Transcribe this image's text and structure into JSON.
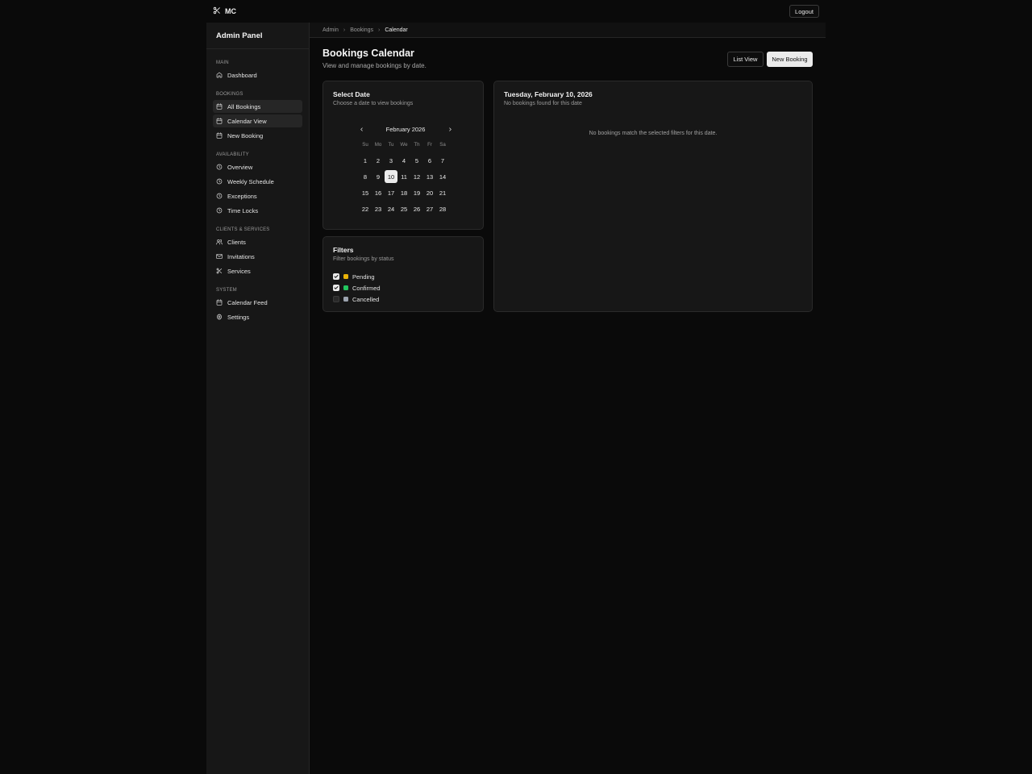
{
  "brand": {
    "name": "MC"
  },
  "topbar": {
    "logout_label": "Logout"
  },
  "sidebar": {
    "title": "Admin Panel",
    "sections": [
      {
        "label": "MAIN",
        "items": [
          {
            "label": "Dashboard",
            "icon": "home-icon",
            "active": false
          }
        ]
      },
      {
        "label": "BOOKINGS",
        "items": [
          {
            "label": "All Bookings",
            "icon": "calendar-icon",
            "active": true
          },
          {
            "label": "Calendar View",
            "icon": "calendar-icon",
            "active": true
          },
          {
            "label": "New Booking",
            "icon": "calendar-icon",
            "active": false
          }
        ]
      },
      {
        "label": "AVAILABILITY",
        "items": [
          {
            "label": "Overview",
            "icon": "clock-icon",
            "active": false
          },
          {
            "label": "Weekly Schedule",
            "icon": "clock-icon",
            "active": false
          },
          {
            "label": "Exceptions",
            "icon": "clock-icon",
            "active": false
          },
          {
            "label": "Time Locks",
            "icon": "clock-icon",
            "active": false
          }
        ]
      },
      {
        "label": "CLIENTS & SERVICES",
        "items": [
          {
            "label": "Clients",
            "icon": "users-icon",
            "active": false
          },
          {
            "label": "Invitations",
            "icon": "mail-icon",
            "active": false
          },
          {
            "label": "Services",
            "icon": "scissors-icon",
            "active": false
          }
        ]
      },
      {
        "label": "SYSTEM",
        "items": [
          {
            "label": "Calendar Feed",
            "icon": "calendar-icon",
            "active": false
          },
          {
            "label": "Settings",
            "icon": "gear-icon",
            "active": false
          }
        ]
      }
    ]
  },
  "breadcrumb": {
    "items": [
      "Admin",
      "Bookings",
      "Calendar"
    ]
  },
  "header": {
    "title": "Bookings Calendar",
    "subtitle": "View and manage bookings by date.",
    "list_view_label": "List View",
    "new_booking_label": "New Booking"
  },
  "calendar_card": {
    "title": "Select Date",
    "subtitle": "Choose a date to view bookings",
    "month_label": "February 2026",
    "weekdays": [
      "Su",
      "Mo",
      "Tu",
      "We",
      "Th",
      "Fr",
      "Sa"
    ],
    "weeks": [
      [
        "1",
        "2",
        "3",
        "4",
        "5",
        "6",
        "7"
      ],
      [
        "8",
        "9",
        "10",
        "11",
        "12",
        "13",
        "14"
      ],
      [
        "15",
        "16",
        "17",
        "18",
        "19",
        "20",
        "21"
      ],
      [
        "22",
        "23",
        "24",
        "25",
        "26",
        "27",
        "28"
      ]
    ],
    "selected_day": "10"
  },
  "filters_card": {
    "title": "Filters",
    "subtitle": "Filter bookings by status",
    "options": [
      {
        "label": "Pending",
        "checked": true,
        "color": "#eab308"
      },
      {
        "label": "Confirmed",
        "checked": true,
        "color": "#22c55e"
      },
      {
        "label": "Cancelled",
        "checked": false,
        "color": "#9ca3af"
      }
    ]
  },
  "day_card": {
    "title": "Tuesday, February 10, 2026",
    "subtitle": "No bookings found for this date",
    "empty_message": "No bookings match the selected filters for this date."
  }
}
